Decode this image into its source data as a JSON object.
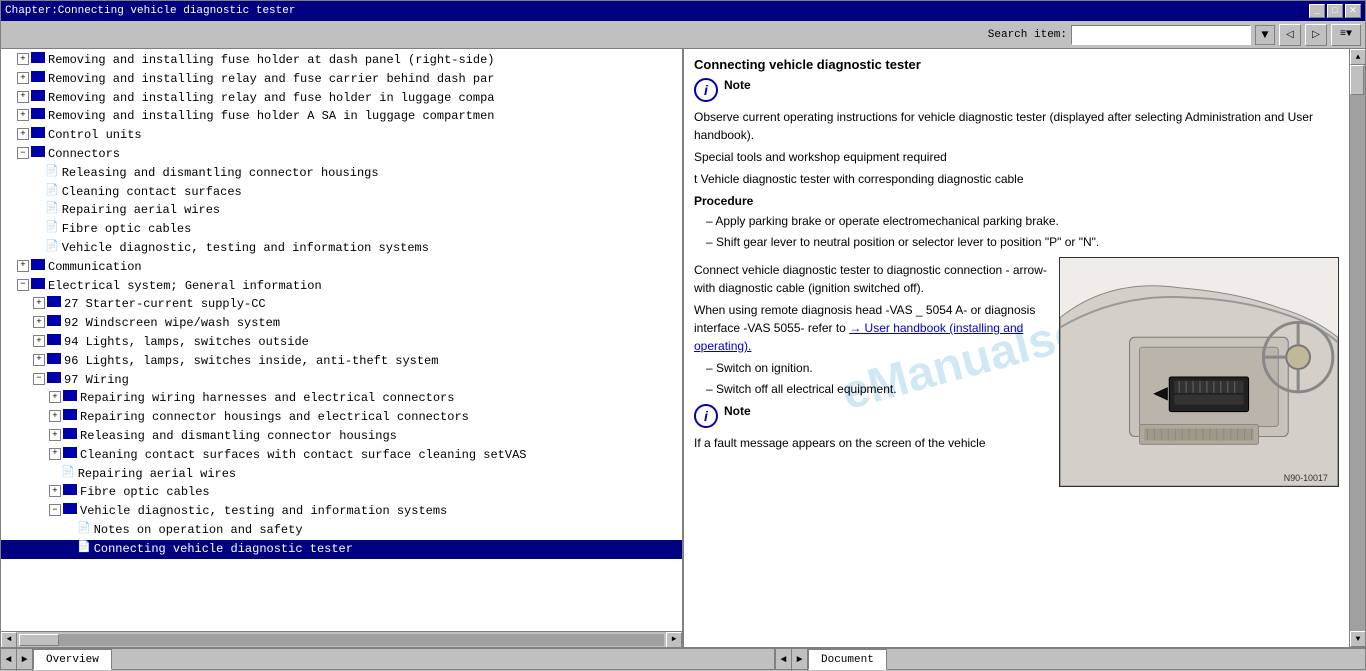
{
  "titleBar": {
    "title": "Chapter:Connecting vehicle diagnostic tester"
  },
  "toolbar": {
    "searchLabel": "Search item:",
    "searchPlaceholder": ""
  },
  "leftPanel": {
    "items": [
      {
        "id": 1,
        "indent": "indent1",
        "type": "expand-doc",
        "text": "Removing and installing fuse holder at dash panel (right-side)"
      },
      {
        "id": 2,
        "indent": "indent1",
        "type": "expand-doc",
        "text": "Removing and installing relay and fuse carrier behind dash pa"
      },
      {
        "id": 3,
        "indent": "indent1",
        "type": "expand-doc",
        "text": "Removing and installing relay and fuse holder in luggage comp"
      },
      {
        "id": 4,
        "indent": "indent1",
        "type": "expand-doc",
        "text": "Removing and installing fuse holder A SA in luggage compartme"
      },
      {
        "id": 5,
        "indent": "indent1",
        "type": "folder",
        "text": "Control units"
      },
      {
        "id": 6,
        "indent": "indent1",
        "type": "folder-open",
        "text": "Connectors"
      },
      {
        "id": 7,
        "indent": "indent2",
        "type": "doc",
        "text": "Releasing and dismantling connector housings"
      },
      {
        "id": 8,
        "indent": "indent2",
        "type": "doc",
        "text": "Cleaning contact surfaces"
      },
      {
        "id": 9,
        "indent": "indent2",
        "type": "doc",
        "text": "Repairing aerial wires"
      },
      {
        "id": 10,
        "indent": "indent2",
        "type": "doc",
        "text": "Fibre optic cables"
      },
      {
        "id": 11,
        "indent": "indent2",
        "type": "doc",
        "text": "Vehicle diagnostic, testing and information systems"
      },
      {
        "id": 12,
        "indent": "indent1",
        "type": "folder",
        "text": "Communication"
      },
      {
        "id": 13,
        "indent": "indent1",
        "type": "doc-open",
        "text": "Electrical system; General information"
      },
      {
        "id": 14,
        "indent": "indent1",
        "type": "folder-open",
        "text": "27 Starter-current supply-CC"
      },
      {
        "id": 15,
        "indent": "indent1",
        "type": "folder-open",
        "text": "92 Windscreen wipe/wash system"
      },
      {
        "id": 16,
        "indent": "indent1",
        "type": "folder-open",
        "text": "94 Lights, lamps, switches outside"
      },
      {
        "id": 17,
        "indent": "indent1",
        "type": "folder-open",
        "text": "96 Lights, lamps, switches inside, anti-theft system"
      },
      {
        "id": 18,
        "indent": "indent1",
        "type": "folder-open2",
        "text": "97 Wiring"
      },
      {
        "id": 19,
        "indent": "indent2",
        "type": "expand-doc",
        "text": "Repairing wiring harnesses and electrical connectors"
      },
      {
        "id": 20,
        "indent": "indent2",
        "type": "expand-doc",
        "text": "Repairing connector housings and electrical connectors"
      },
      {
        "id": 21,
        "indent": "indent2",
        "type": "expand-doc",
        "text": "Releasing and dismantling connector housings"
      },
      {
        "id": 22,
        "indent": "indent2",
        "type": "expand-doc",
        "text": "Cleaning contact surfaces with contact surface cleaning setVAS"
      },
      {
        "id": 23,
        "indent": "indent2",
        "type": "doc",
        "text": "Repairing aerial wires"
      },
      {
        "id": 24,
        "indent": "indent2",
        "type": "expand-doc",
        "text": "Fibre optic cables"
      },
      {
        "id": 25,
        "indent": "indent2",
        "type": "folder-open3",
        "text": "Vehicle diagnostic, testing and information systems"
      },
      {
        "id": 26,
        "indent": "indent3",
        "type": "doc",
        "text": "Notes on operation and safety"
      },
      {
        "id": 27,
        "indent": "indent3",
        "type": "doc-active",
        "text": "Connecting vehicle diagnostic tester"
      }
    ]
  },
  "rightPanel": {
    "title": "Connecting vehicle diagnostic tester",
    "noteLabel": "Note",
    "note1Text": "Observe current operating instructions for vehicle diagnostic tester (displayed after selecting Administration and User handbook).",
    "specialToolsLabel": "Special tools and workshop equipment required",
    "toolItem": "t  Vehicle diagnostic tester with corresponding diagnostic cable",
    "procedureLabel": "Procedure",
    "steps": [
      "Apply parking brake or operate electromechanical parking brake.",
      "Shift gear lever to neutral position or selector lever to position \"P\" or \"N\"."
    ],
    "connectText": "Connect vehicle diagnostic tester to diagnostic connection - arrow- with diagnostic cable (ignition switched off).",
    "remoteText": "When using remote diagnosis head -VAS _ 5054 A- or diagnosis interface -VAS 5055- refer to",
    "linkText": "→ User handbook (installing and operating).",
    "step3": "Switch on ignition.",
    "step4": "Switch off all electrical equipment.",
    "note2Label": "Note",
    "note2Text": "If a fault message appears on the screen of the vehicle",
    "diagramLabel": "N90-10017",
    "watermark": "eManualsonline"
  },
  "bottomTabs": {
    "leftTabs": [
      {
        "label": "Overview",
        "active": true
      }
    ],
    "rightTabs": [
      {
        "label": "Document",
        "active": true
      }
    ]
  }
}
